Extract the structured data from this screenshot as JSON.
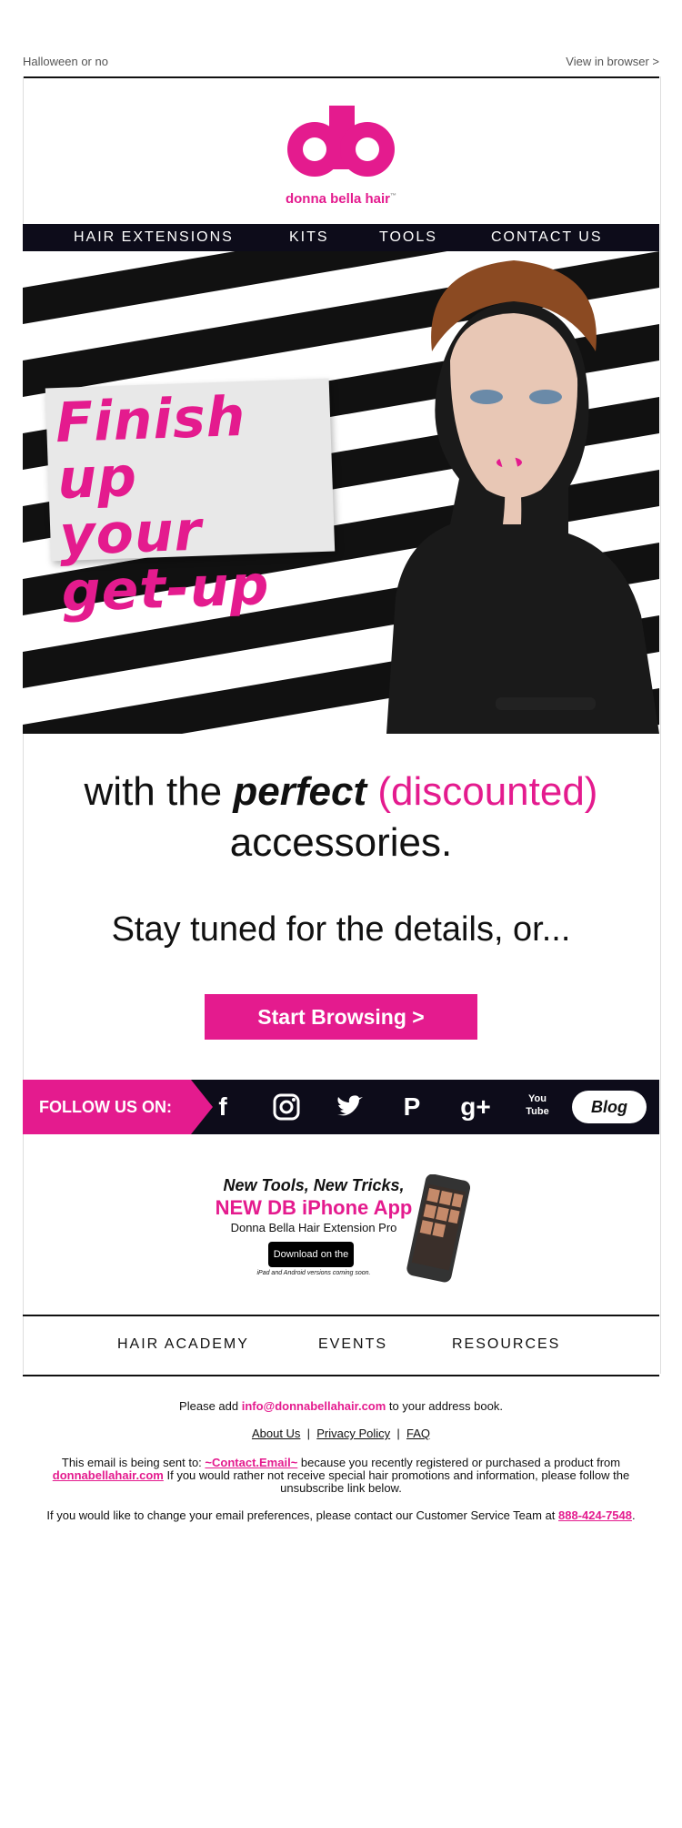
{
  "preheader": {
    "left": "Halloween or no",
    "right": "View in browser >"
  },
  "brand": {
    "logo_letters": "db",
    "name": "donna bella hair",
    "tm": "™",
    "color": "#e41b8e"
  },
  "nav": {
    "items": [
      "HAIR EXTENSIONS",
      "KITS",
      "TOOLS",
      "CONTACT US"
    ]
  },
  "hero": {
    "tag_lines": [
      "Finish up",
      "your",
      "get-up"
    ]
  },
  "headline": {
    "part1": "with the ",
    "emph": "perfect",
    "part2": " (discounted)",
    "line2": "accessories."
  },
  "subhead": "Stay tuned for the details, or...",
  "cta": {
    "label": "Start Browsing >"
  },
  "social": {
    "follow_label": "FOLLOW US ON:",
    "icons": [
      "facebook-icon",
      "instagram-icon",
      "twitter-icon",
      "pinterest-icon",
      "google-plus-icon",
      "youtube-icon"
    ],
    "blog_label": "Blog"
  },
  "app": {
    "line1": "New Tools, New Tricks,",
    "line2": "NEW DB iPhone App",
    "line3": "Donna Bella Hair Extension Pro",
    "store_label": "Download on the App Store",
    "note": "iPad and Android versions coming soon."
  },
  "bottom_nav": {
    "items": [
      "HAIR ACADEMY",
      "EVENTS",
      "RESOURCES"
    ]
  },
  "footer": {
    "add_text1": "Please add ",
    "add_email": "info@donnabellahair.com",
    "add_text2": " to your address book.",
    "links": [
      "About Us",
      "Privacy Policy",
      "FAQ"
    ],
    "sent_text1": "This email is being sent to: ",
    "sent_contact": "~Contact.Email~",
    "sent_text2": " because you recently registered or purchased a product from ",
    "sent_site": "donnabellahair.com",
    "sent_text3": "  If you would rather not receive special hair promotions and information, please follow the unsubscribe link below.",
    "pref_text": "If you would like to change your email preferences, please contact our Customer Service Team at ",
    "phone": "888-424-7548",
    "period": "."
  }
}
